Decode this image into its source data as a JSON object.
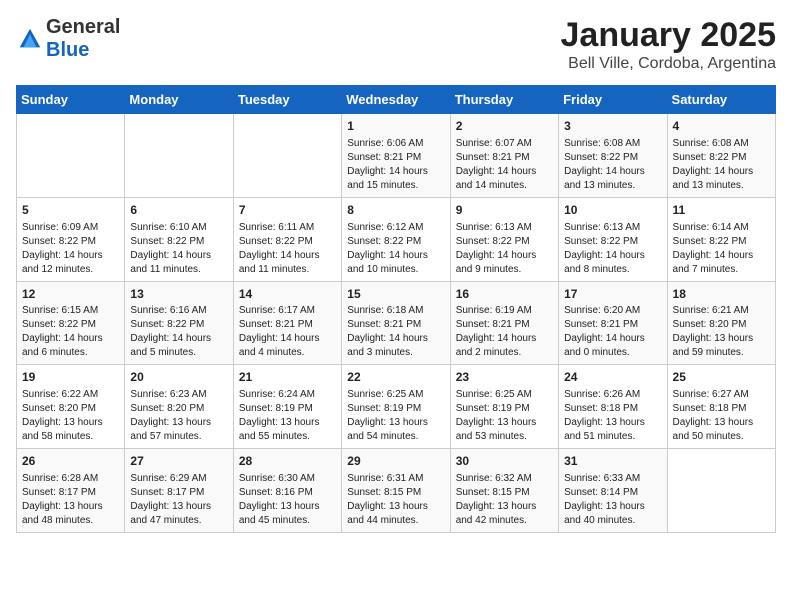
{
  "header": {
    "logo_line1": "General",
    "logo_line2": "Blue",
    "month_title": "January 2025",
    "location": "Bell Ville, Cordoba, Argentina"
  },
  "weekdays": [
    "Sunday",
    "Monday",
    "Tuesday",
    "Wednesday",
    "Thursday",
    "Friday",
    "Saturday"
  ],
  "weeks": [
    [
      {
        "day": "",
        "info": ""
      },
      {
        "day": "",
        "info": ""
      },
      {
        "day": "",
        "info": ""
      },
      {
        "day": "1",
        "info": "Sunrise: 6:06 AM\nSunset: 8:21 PM\nDaylight: 14 hours and 15 minutes."
      },
      {
        "day": "2",
        "info": "Sunrise: 6:07 AM\nSunset: 8:21 PM\nDaylight: 14 hours and 14 minutes."
      },
      {
        "day": "3",
        "info": "Sunrise: 6:08 AM\nSunset: 8:22 PM\nDaylight: 14 hours and 13 minutes."
      },
      {
        "day": "4",
        "info": "Sunrise: 6:08 AM\nSunset: 8:22 PM\nDaylight: 14 hours and 13 minutes."
      }
    ],
    [
      {
        "day": "5",
        "info": "Sunrise: 6:09 AM\nSunset: 8:22 PM\nDaylight: 14 hours and 12 minutes."
      },
      {
        "day": "6",
        "info": "Sunrise: 6:10 AM\nSunset: 8:22 PM\nDaylight: 14 hours and 11 minutes."
      },
      {
        "day": "7",
        "info": "Sunrise: 6:11 AM\nSunset: 8:22 PM\nDaylight: 14 hours and 11 minutes."
      },
      {
        "day": "8",
        "info": "Sunrise: 6:12 AM\nSunset: 8:22 PM\nDaylight: 14 hours and 10 minutes."
      },
      {
        "day": "9",
        "info": "Sunrise: 6:13 AM\nSunset: 8:22 PM\nDaylight: 14 hours and 9 minutes."
      },
      {
        "day": "10",
        "info": "Sunrise: 6:13 AM\nSunset: 8:22 PM\nDaylight: 14 hours and 8 minutes."
      },
      {
        "day": "11",
        "info": "Sunrise: 6:14 AM\nSunset: 8:22 PM\nDaylight: 14 hours and 7 minutes."
      }
    ],
    [
      {
        "day": "12",
        "info": "Sunrise: 6:15 AM\nSunset: 8:22 PM\nDaylight: 14 hours and 6 minutes."
      },
      {
        "day": "13",
        "info": "Sunrise: 6:16 AM\nSunset: 8:22 PM\nDaylight: 14 hours and 5 minutes."
      },
      {
        "day": "14",
        "info": "Sunrise: 6:17 AM\nSunset: 8:21 PM\nDaylight: 14 hours and 4 minutes."
      },
      {
        "day": "15",
        "info": "Sunrise: 6:18 AM\nSunset: 8:21 PM\nDaylight: 14 hours and 3 minutes."
      },
      {
        "day": "16",
        "info": "Sunrise: 6:19 AM\nSunset: 8:21 PM\nDaylight: 14 hours and 2 minutes."
      },
      {
        "day": "17",
        "info": "Sunrise: 6:20 AM\nSunset: 8:21 PM\nDaylight: 14 hours and 0 minutes."
      },
      {
        "day": "18",
        "info": "Sunrise: 6:21 AM\nSunset: 8:20 PM\nDaylight: 13 hours and 59 minutes."
      }
    ],
    [
      {
        "day": "19",
        "info": "Sunrise: 6:22 AM\nSunset: 8:20 PM\nDaylight: 13 hours and 58 minutes."
      },
      {
        "day": "20",
        "info": "Sunrise: 6:23 AM\nSunset: 8:20 PM\nDaylight: 13 hours and 57 minutes."
      },
      {
        "day": "21",
        "info": "Sunrise: 6:24 AM\nSunset: 8:19 PM\nDaylight: 13 hours and 55 minutes."
      },
      {
        "day": "22",
        "info": "Sunrise: 6:25 AM\nSunset: 8:19 PM\nDaylight: 13 hours and 54 minutes."
      },
      {
        "day": "23",
        "info": "Sunrise: 6:25 AM\nSunset: 8:19 PM\nDaylight: 13 hours and 53 minutes."
      },
      {
        "day": "24",
        "info": "Sunrise: 6:26 AM\nSunset: 8:18 PM\nDaylight: 13 hours and 51 minutes."
      },
      {
        "day": "25",
        "info": "Sunrise: 6:27 AM\nSunset: 8:18 PM\nDaylight: 13 hours and 50 minutes."
      }
    ],
    [
      {
        "day": "26",
        "info": "Sunrise: 6:28 AM\nSunset: 8:17 PM\nDaylight: 13 hours and 48 minutes."
      },
      {
        "day": "27",
        "info": "Sunrise: 6:29 AM\nSunset: 8:17 PM\nDaylight: 13 hours and 47 minutes."
      },
      {
        "day": "28",
        "info": "Sunrise: 6:30 AM\nSunset: 8:16 PM\nDaylight: 13 hours and 45 minutes."
      },
      {
        "day": "29",
        "info": "Sunrise: 6:31 AM\nSunset: 8:15 PM\nDaylight: 13 hours and 44 minutes."
      },
      {
        "day": "30",
        "info": "Sunrise: 6:32 AM\nSunset: 8:15 PM\nDaylight: 13 hours and 42 minutes."
      },
      {
        "day": "31",
        "info": "Sunrise: 6:33 AM\nSunset: 8:14 PM\nDaylight: 13 hours and 40 minutes."
      },
      {
        "day": "",
        "info": ""
      }
    ]
  ]
}
